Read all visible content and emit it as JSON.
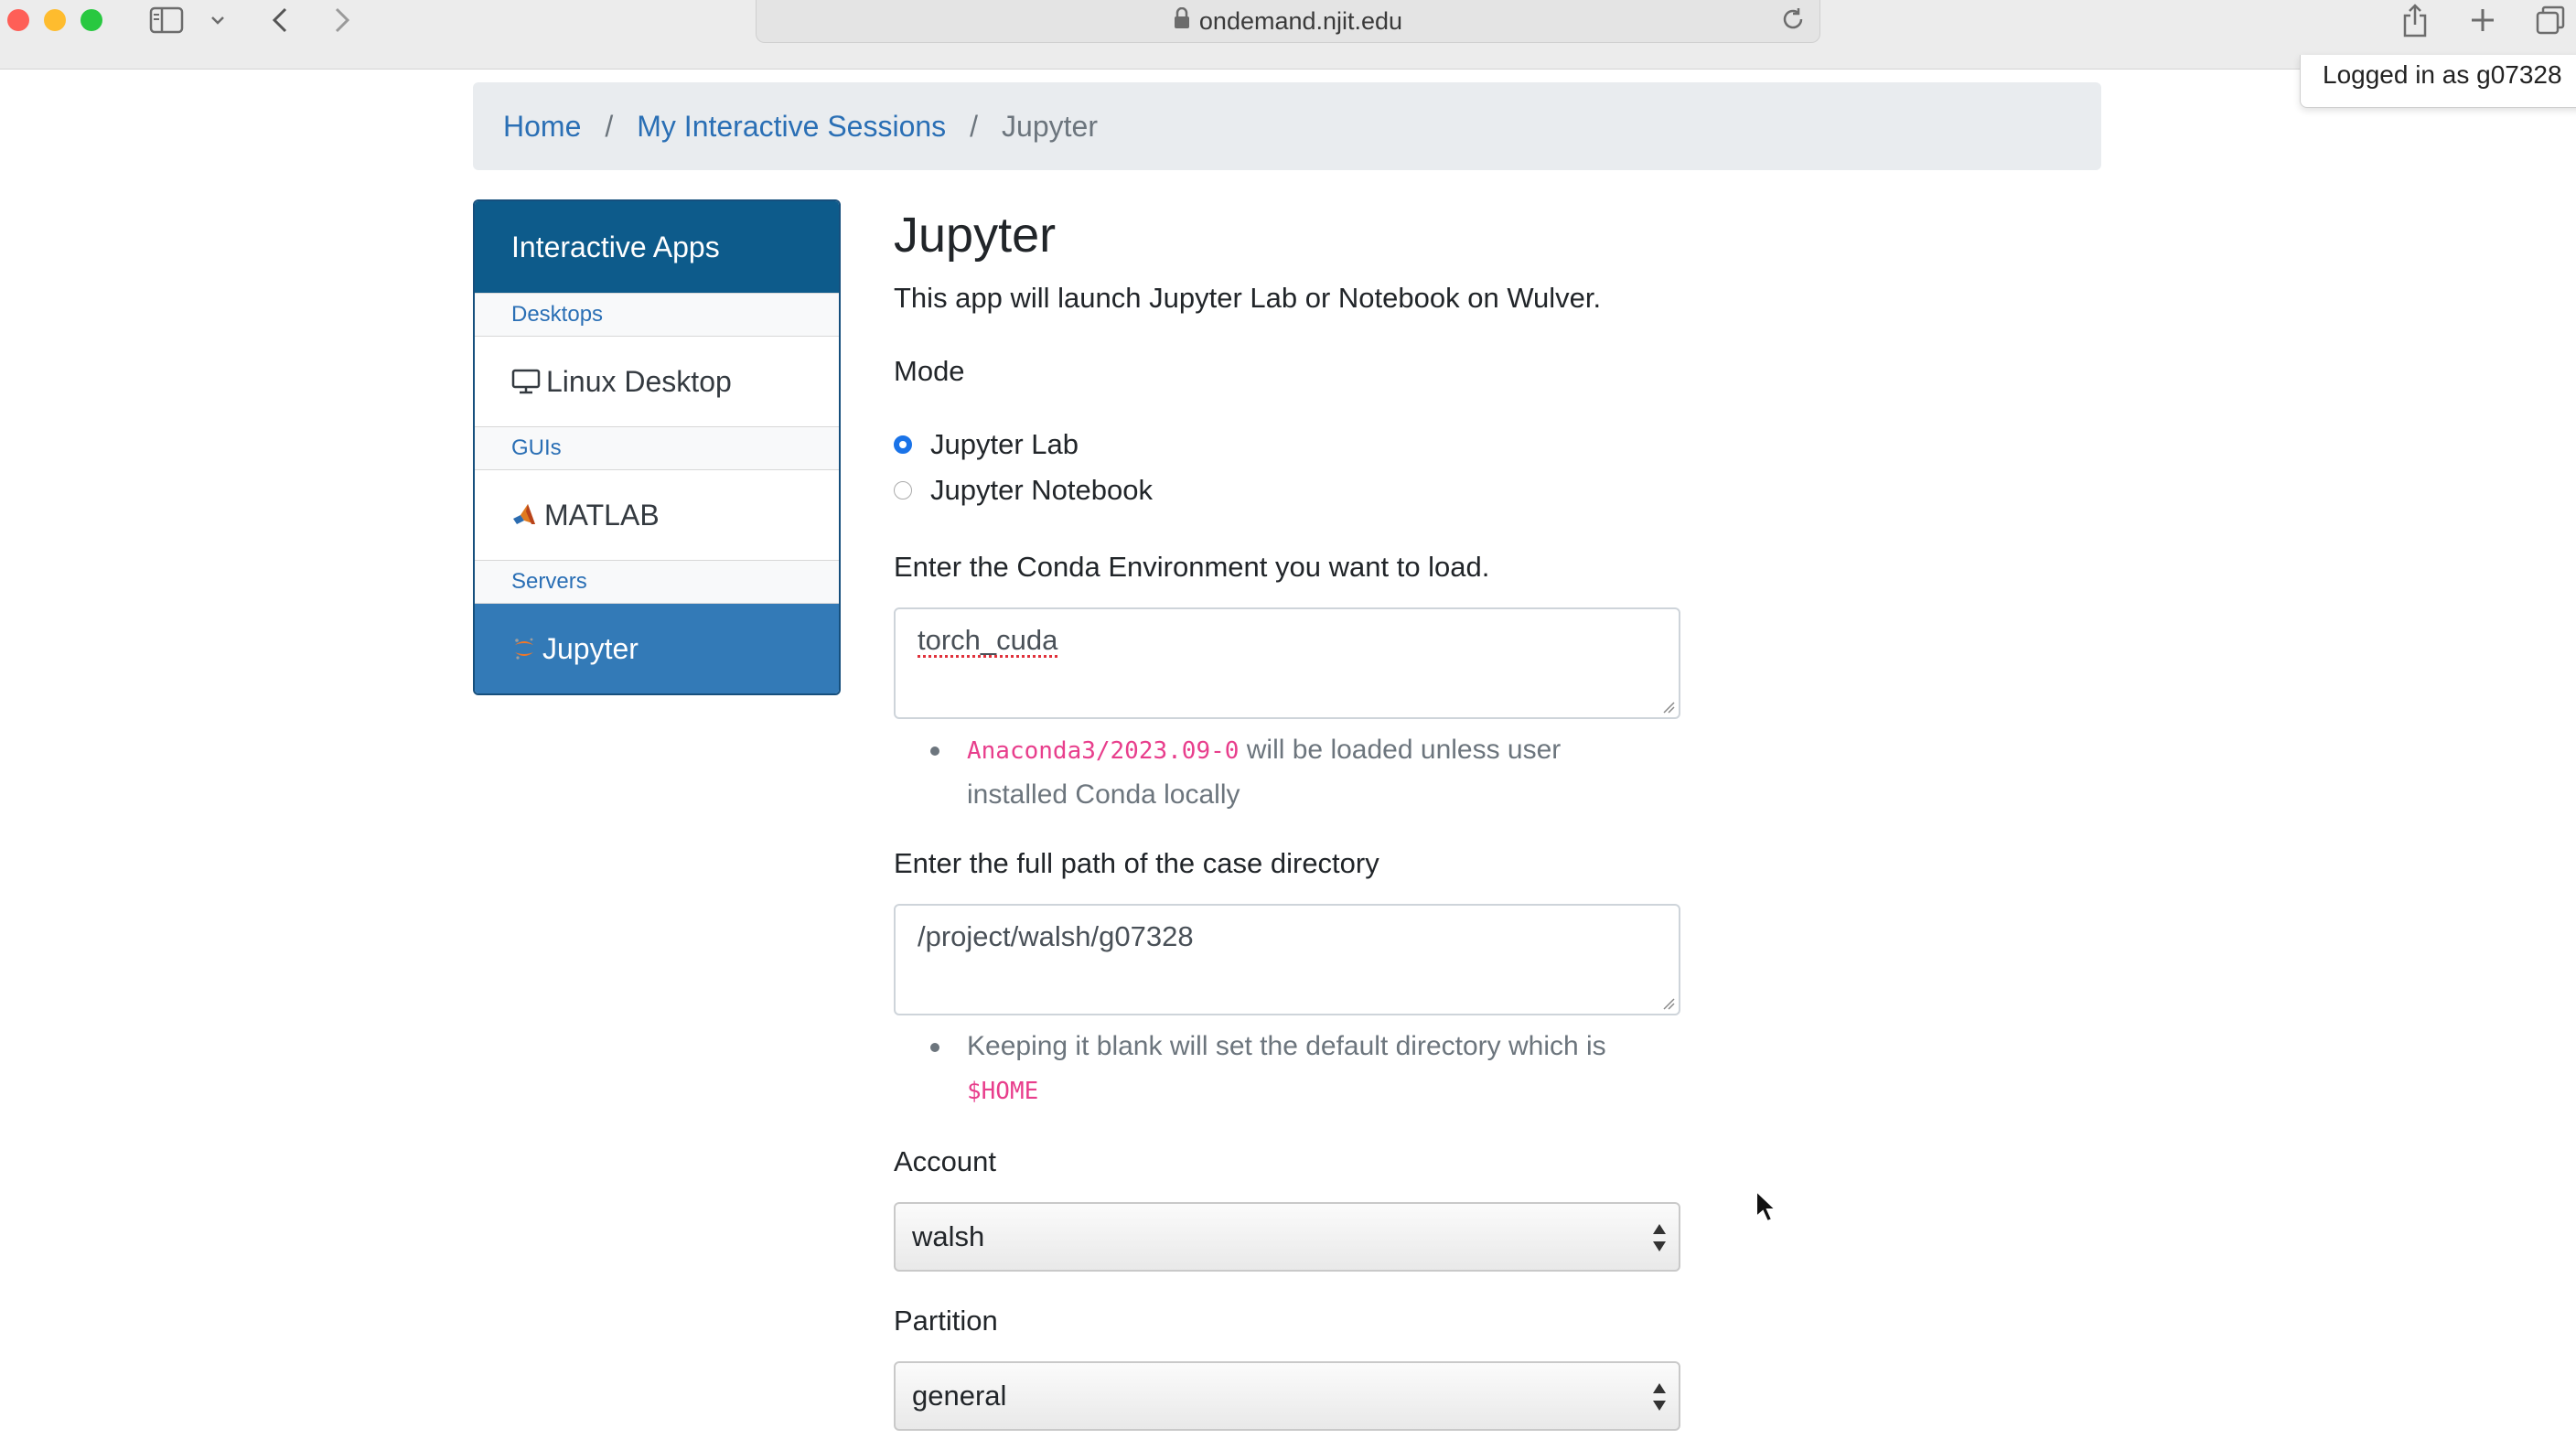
{
  "browser": {
    "url": "ondemand.njit.edu",
    "icons": [
      "sidebar-icon",
      "chevron-down-icon",
      "back-icon",
      "forward-icon",
      "lock-icon",
      "reload-icon",
      "share-icon",
      "new-tab-icon",
      "tab-overview-icon"
    ]
  },
  "user": {
    "logged_in_text": "Logged in as g07328"
  },
  "breadcrumb": {
    "items": [
      "Home",
      "My Interactive Sessions",
      "Jupyter"
    ],
    "separator": "/"
  },
  "sidebar": {
    "header": "Interactive Apps",
    "categories": [
      {
        "label": "Desktops",
        "items": [
          {
            "label": "Linux Desktop",
            "icon": "monitor-icon"
          }
        ]
      },
      {
        "label": "GUIs",
        "items": [
          {
            "label": "MATLAB",
            "icon": "matlab-icon"
          }
        ]
      },
      {
        "label": "Servers",
        "items": [
          {
            "label": "Jupyter",
            "icon": "jupyter-icon",
            "active": true
          }
        ]
      }
    ]
  },
  "form": {
    "title": "Jupyter",
    "description": "This app will launch Jupyter Lab or Notebook on Wulver.",
    "mode": {
      "label": "Mode",
      "options": [
        "Jupyter Lab",
        "Jupyter Notebook"
      ],
      "selected": "Jupyter Lab"
    },
    "conda": {
      "label": "Enter the Conda Environment you want to load.",
      "value": "torch_cuda",
      "help_code": "Anaconda3/2023.09-0",
      "help_text": " will be loaded unless user installed Conda locally"
    },
    "case_dir": {
      "label": "Enter the full path of the case directory",
      "value": "/project/walsh/g07328",
      "help_text": "Keeping it blank will set the default directory which is ",
      "help_code": "$HOME"
    },
    "account": {
      "label": "Account",
      "value": "walsh"
    },
    "partition": {
      "label": "Partition",
      "value": "general"
    }
  },
  "colors": {
    "sidebar_header": "#0d5b8b",
    "active_item": "#337ab7",
    "link": "#2a6fb5",
    "code": "#e83e8c",
    "radio_checked": "#1a73e8"
  }
}
